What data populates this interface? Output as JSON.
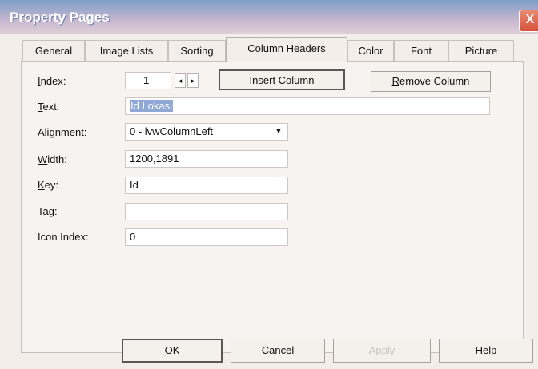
{
  "window": {
    "title": "Property Pages",
    "close_label": "X"
  },
  "tabs": [
    {
      "label": "General"
    },
    {
      "label": "Image Lists"
    },
    {
      "label": "Sorting"
    },
    {
      "label": "Column Headers"
    },
    {
      "label": "Color"
    },
    {
      "label": "Font"
    },
    {
      "label": "Picture"
    }
  ],
  "form": {
    "index": {
      "label_pre": "",
      "label_u": "I",
      "label_post": "ndex:",
      "value": "1",
      "left_arrow": "◂",
      "right_arrow": "▸"
    },
    "insert_button": {
      "label_u": "I",
      "label_post": "nsert Column"
    },
    "remove_button": {
      "label_u": "R",
      "label_post": "emove Column"
    },
    "text": {
      "label_u": "T",
      "label_post": "ext:",
      "value": "Id Lokasi"
    },
    "alignment": {
      "label_pre": "Alig",
      "label_u": "n",
      "label_post": "ment:",
      "value": "0 - lvwColumnLeft",
      "arrow": "▼"
    },
    "width": {
      "label_u": "W",
      "label_post": "idth:",
      "value": "1200,1891"
    },
    "key": {
      "label_u": "K",
      "label_post": "ey:",
      "value": "Id"
    },
    "tag": {
      "label_pre": "Ta",
      "label_u": "g",
      "label_post": ":",
      "value": ""
    },
    "icon_index": {
      "label": "Icon Index:",
      "value": "0"
    }
  },
  "bottom": {
    "ok": "OK",
    "cancel": "Cancel",
    "apply": "Apply",
    "help": "Help"
  }
}
